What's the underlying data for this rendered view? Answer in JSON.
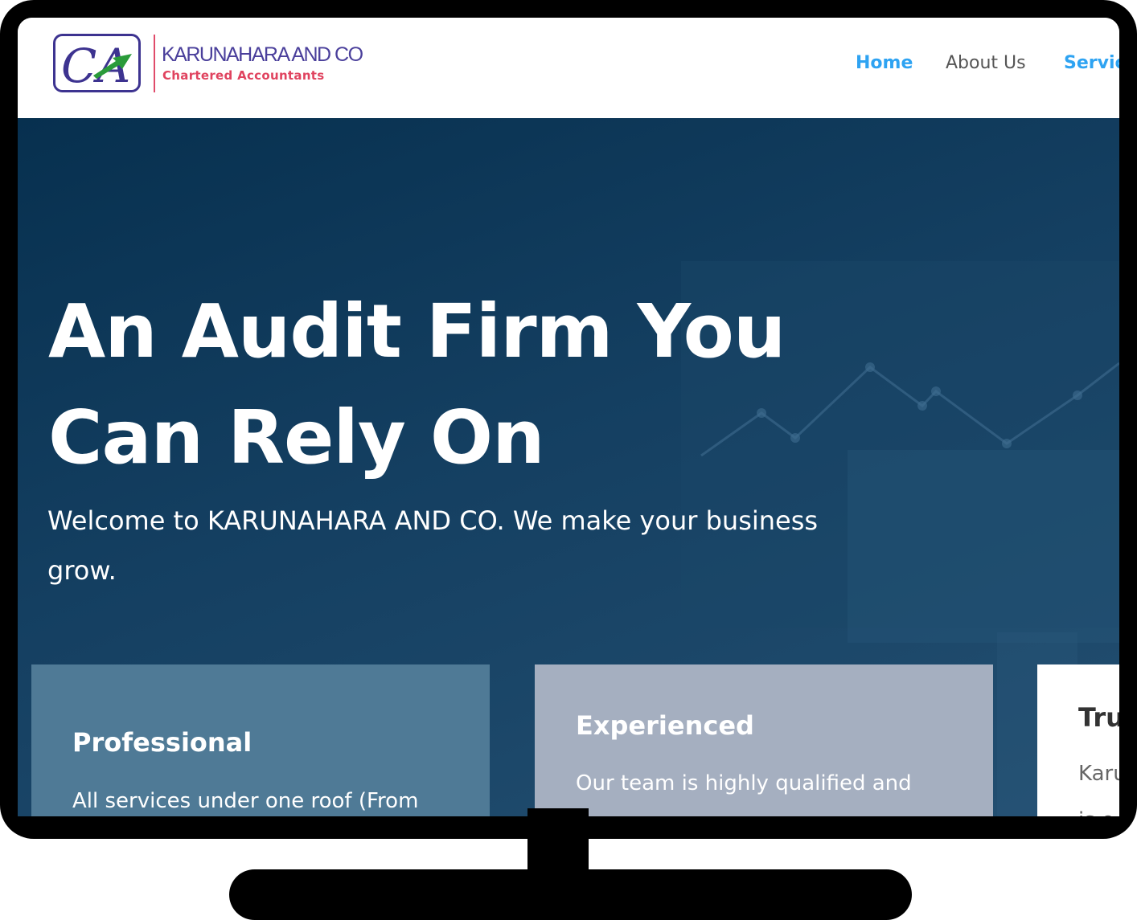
{
  "header": {
    "logo_monogram": "CA",
    "company_name": "KARUNAHARA AND CO",
    "tagline": "Chartered Accountants",
    "nav": [
      {
        "label": "Home",
        "active": true
      },
      {
        "label": "About Us",
        "active": false
      },
      {
        "label": "Servic",
        "active": false
      }
    ]
  },
  "hero": {
    "title_line1": "An Audit Firm You",
    "title_line2": "Can Rely On",
    "subtitle_line1": "Welcome to KARUNAHARA AND CO. We make your business",
    "subtitle_line2": "grow."
  },
  "cards": [
    {
      "title": "Professional",
      "text": "All services under one roof (From"
    },
    {
      "title": "Experienced",
      "text": "Our team is highly qualified and"
    },
    {
      "title": "Tru",
      "text_line1": "Karu",
      "text_line2": "is o"
    }
  ],
  "colors": {
    "nav_active": "#2ea3f2",
    "brand_purple": "#4a3f9b",
    "brand_pink": "#e0435f",
    "hero_bg": "#143f61",
    "card_professional": "#4f7a96",
    "card_experienced": "#a5afc0"
  }
}
